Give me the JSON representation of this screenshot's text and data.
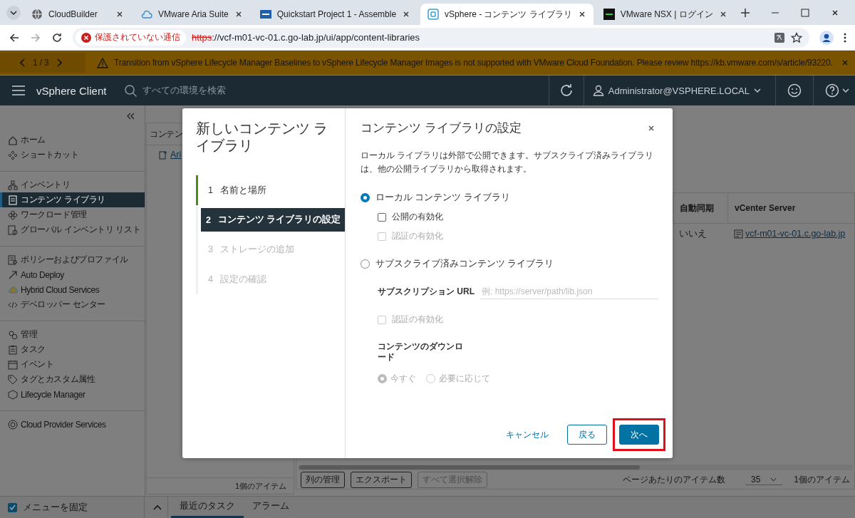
{
  "browser": {
    "tabs": [
      {
        "title": "CloudBuilder",
        "selected": false
      },
      {
        "title": "VMware Aria Suite",
        "selected": false
      },
      {
        "title": "Quickstart Project 1 - Assemble",
        "selected": false
      },
      {
        "title": "vSphere - コンテンツ ライブラリ",
        "selected": true
      },
      {
        "title": "VMware NSX | ログイン",
        "selected": false
      }
    ],
    "security_chip": "保護されていない通信",
    "url_scheme": "https",
    "url_rest": "://vcf-m01-vc-01.c.go-lab.jp/ui/app/content-libraries"
  },
  "banner": {
    "pager": "1 / 3",
    "message": "Transition from vSphere Lifecycle Manager Baselines to vSphere Lifecycle Manager Images is not supported with VMware Cloud Foundation. Please review https://kb.vmware.com/s/article/93220."
  },
  "header": {
    "title": "vSphere Client",
    "search_placeholder": "すべての環境を検索",
    "user": "Administrator@VSPHERE.LOCAL"
  },
  "sidebar": {
    "groups": [
      {
        "items": [
          {
            "label": "ホーム",
            "selected": false
          },
          {
            "label": "ショートカット",
            "selected": false
          }
        ]
      },
      {
        "items": [
          {
            "label": "インベントリ",
            "selected": false
          },
          {
            "label": "コンテンツ ライブラリ",
            "selected": true
          },
          {
            "label": "ワークロード管理",
            "selected": false
          },
          {
            "label": "グローバル インベントリ リスト",
            "selected": false
          }
        ]
      },
      {
        "items": [
          {
            "label": "ポリシーおよびプロファイル",
            "selected": false
          },
          {
            "label": "Auto Deploy",
            "selected": false
          },
          {
            "label": "Hybrid Cloud Services",
            "selected": false
          },
          {
            "label": "デベロッパー センター",
            "selected": false
          }
        ]
      },
      {
        "items": [
          {
            "label": "管理",
            "selected": false
          },
          {
            "label": "タスク",
            "selected": false
          },
          {
            "label": "イベント",
            "selected": false
          },
          {
            "label": "タグとカスタム属性",
            "selected": false
          },
          {
            "label": "Lifecycle Manager",
            "selected": false
          }
        ]
      },
      {
        "items": [
          {
            "label": "Cloud Provider Services",
            "selected": false
          }
        ]
      }
    ]
  },
  "library_list": {
    "column_1": "コンテン",
    "item": "Ari",
    "footer": "1個のアイテム"
  },
  "table": {
    "columns": [
      "自動同期",
      "vCenter Server"
    ],
    "rows": [
      [
        "いいえ",
        "vcf-m01-vc-01.c.go-lab.jp"
      ]
    ],
    "actions": [
      {
        "label": "列の管理",
        "disabled": false
      },
      {
        "label": "エクスポート",
        "disabled": false
      },
      {
        "label": "すべて選択解除",
        "disabled": true
      }
    ],
    "page_size_label": "ページあたりのアイテム数",
    "page_size": "35",
    "footer": "1個のアイテム"
  },
  "bottom_bar": {
    "pin_menu": {
      "label": "メニューを固定",
      "checked": true
    },
    "tabs": [
      {
        "label": "最近のタスク",
        "selected": true
      },
      {
        "label": "アラーム",
        "selected": false
      }
    ]
  },
  "dialog": {
    "title": "新しいコンテンツ ライブラリ",
    "steps": [
      {
        "number": "1",
        "label": "名前と場所",
        "completed": true,
        "selected": false,
        "disabled": false
      },
      {
        "number": "2",
        "label": "コンテンツ ライブラリの設定",
        "completed": false,
        "selected": true,
        "disabled": false
      },
      {
        "number": "3",
        "label": "ストレージの追加",
        "completed": false,
        "selected": false,
        "disabled": true
      },
      {
        "number": "4",
        "label": "設定の確認",
        "completed": false,
        "selected": false,
        "disabled": true
      }
    ],
    "heading": "コンテンツ ライブラリの設定",
    "description": "ローカル ライブラリは外部で公開できます。サブスクライブ済みライブラリは、他の公開ライブラリから取得されます。",
    "library_types": [
      {
        "label": "ローカル コンテンツ ライブラリ",
        "selected": true,
        "options": [
          {
            "kind": "checkbox",
            "label": "公開の有効化",
            "checked": false,
            "disabled": false
          },
          {
            "kind": "checkbox",
            "label": "認証の有効化",
            "checked": false,
            "disabled": true
          }
        ]
      },
      {
        "label": "サブスクライブ済みコンテンツ ライブラリ",
        "selected": false,
        "options": [
          {
            "kind": "field",
            "label": "サブスクリプション URL",
            "placeholder": "例: https://server/path/lib.json",
            "disabled": true
          },
          {
            "kind": "checkbox",
            "label": "認証の有効化",
            "checked": false,
            "disabled": true
          },
          {
            "kind": "radio_group",
            "label": "コンテンツのダウンロード",
            "disabled": true,
            "choices": [
              {
                "label": "今すぐ",
                "selected": true
              },
              {
                "label": "必要に応じて",
                "selected": false
              }
            ]
          }
        ]
      }
    ],
    "buttons": [
      {
        "kind": "link",
        "label": "キャンセル",
        "highlighted": false
      },
      {
        "kind": "outline",
        "label": "戻る",
        "highlighted": false
      },
      {
        "kind": "primary",
        "label": "次へ",
        "highlighted": true
      }
    ]
  }
}
